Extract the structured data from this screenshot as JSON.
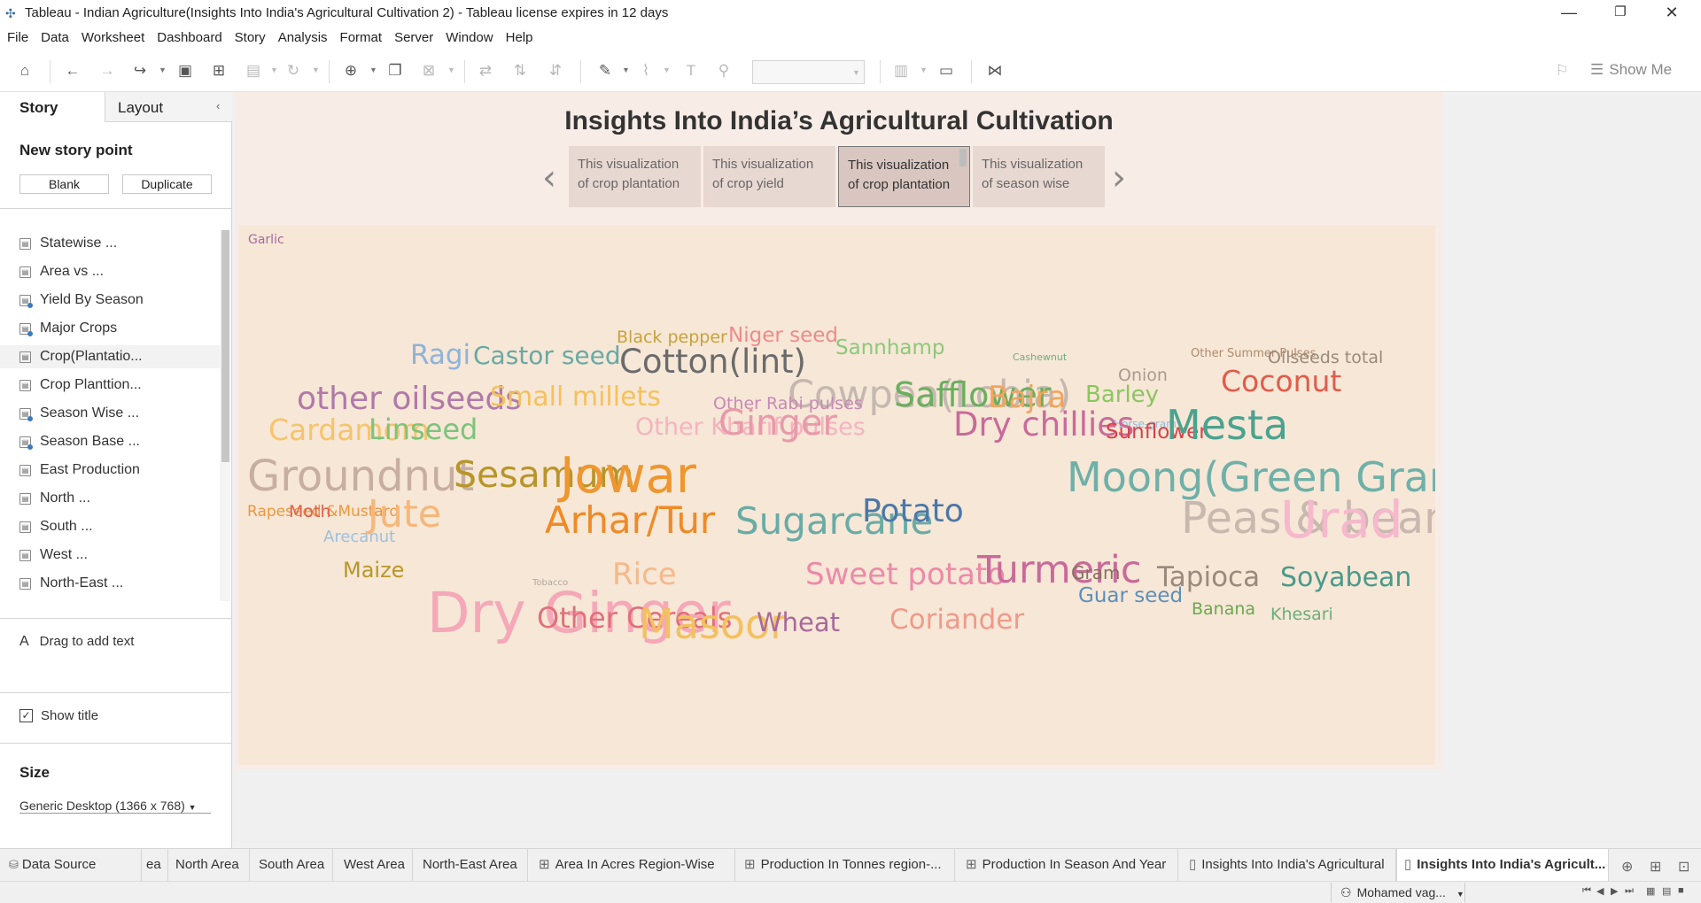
{
  "window": {
    "title": "Tableau - Indian Agriculture(Insights Into India's Agricultural Cultivation 2) - Tableau license expires in 12 days",
    "minimize": "—",
    "restore": "❐",
    "close": "✕"
  },
  "menu": [
    "File",
    "Data",
    "Worksheet",
    "Dashboard",
    "Story",
    "Analysis",
    "Format",
    "Server",
    "Window",
    "Help"
  ],
  "toolbar": {
    "show_me": "Show Me"
  },
  "left_panel": {
    "tab_story": "Story",
    "tab_layout": "Layout",
    "new_story_point": "New story point",
    "blank_button": "Blank",
    "duplicate_button": "Duplicate",
    "sheets": [
      "Statewise ...",
      "Area vs ...",
      "Yield By Season",
      "Major Crops",
      "Crop(Plantatio...",
      "Crop Planttion...",
      "Season Wise ...",
      "Season Base ...",
      "East Production",
      "North ...",
      "South ...",
      "West ...",
      "North-East ..."
    ],
    "drag_to_add_text": "Drag to add text",
    "show_title": "Show title",
    "size_label": "Size",
    "size_value": "Generic Desktop (1366 x 768)"
  },
  "story": {
    "title": "Insights Into India’s Agricultural Cultivation",
    "points": [
      {
        "line1": "This visualization",
        "line2": "of crop plantation"
      },
      {
        "line1": "This visualization",
        "line2": "of crop yield"
      },
      {
        "line1": "This visualization",
        "line2": "of crop plantation"
      },
      {
        "line1": "This visualization",
        "line2": "of season wise"
      }
    ],
    "active_point": 2
  },
  "word_cloud": [
    {
      "text": "Black pepper",
      "color": "#c9a23a"
    },
    {
      "text": "Niger seed",
      "color": "#f08a8a"
    },
    {
      "text": "Sannhamp",
      "color": "#8cc97a"
    },
    {
      "text": "Ragi",
      "color": "#8fb3d9"
    },
    {
      "text": "Castor seed",
      "color": "#6aa9a3"
    },
    {
      "text": "Cotton(lint)",
      "color": "#6b6b6b"
    },
    {
      "text": "Cashewnut",
      "color": "#6aaf7a"
    },
    {
      "text": "Other Summer Pulses",
      "color": "#b08a6a"
    },
    {
      "text": "Oilseeds total",
      "color": "#9a8a7a"
    },
    {
      "text": "Cowpea(Lobia)",
      "color": "#c4b8b0"
    },
    {
      "text": "Onion",
      "color": "#a89a8e"
    },
    {
      "text": "other oilseeds",
      "color": "#b07aa8"
    },
    {
      "text": "Small millets",
      "color": "#f3c15e"
    },
    {
      "text": "Other Rabi pulses",
      "color": "#c78ab3"
    },
    {
      "text": "Safflower",
      "color": "#6aaf5e"
    },
    {
      "text": "Bajra",
      "color": "#f5a35c"
    },
    {
      "text": "Barley",
      "color": "#8bc65e"
    },
    {
      "text": "Coconut",
      "color": "#e25b4a"
    },
    {
      "text": "Horse-gram",
      "color": "#8fbbe0"
    },
    {
      "text": "Cardamom",
      "color": "#f5c46b"
    },
    {
      "text": "Linseed",
      "color": "#7cc47a"
    },
    {
      "text": "Other Kharif pulses",
      "color": "#f5b3c0"
    },
    {
      "text": "Ginger",
      "color": "#e89aaa"
    },
    {
      "text": "Dry chillies",
      "color": "#c96a9a"
    },
    {
      "text": "Sunflower",
      "color": "#d9414a"
    },
    {
      "text": "Mesta",
      "color": "#4aa38f"
    },
    {
      "text": "Groundnut",
      "color": "#c7aea0"
    },
    {
      "text": "Sesamum",
      "color": "#b8952a"
    },
    {
      "text": "Jowar",
      "color": "#f0962e"
    },
    {
      "text": "Moong(Green Gram)",
      "color": "#6fb0a8"
    },
    {
      "text": "Rapeseed &Mustard",
      "color": "#f0963a"
    },
    {
      "text": "Moth",
      "color": "#e0614e"
    },
    {
      "text": "Arecanut",
      "color": "#9ec0de"
    },
    {
      "text": "Jute",
      "color": "#f5b77a"
    },
    {
      "text": "Arhar/Tur",
      "color": "#f08a25"
    },
    {
      "text": "Sugarcane",
      "color": "#6aaba5"
    },
    {
      "text": "Potato",
      "color": "#4b77a8"
    },
    {
      "text": "Peas & beans (Pulses)",
      "color": "#c8b8b0"
    },
    {
      "text": "Urad",
      "color": "#f5b8cc"
    },
    {
      "text": "Maize",
      "color": "#b89828"
    },
    {
      "text": "Tobacco",
      "color": "#b0a8a0"
    },
    {
      "text": "Dry Ginger",
      "color": "#f5a8b8"
    },
    {
      "text": "Rice",
      "color": "#f5b98a"
    },
    {
      "text": "Sweet potato",
      "color": "#ec8aa8"
    },
    {
      "text": "Turmeric",
      "color": "#c96a9a"
    },
    {
      "text": "Gram",
      "color": "#8a7060"
    },
    {
      "text": "Guar seed",
      "color": "#5e8fb8"
    },
    {
      "text": "Tapioca",
      "color": "#9a8a7e"
    },
    {
      "text": "Soyabean",
      "color": "#4a9a8a"
    },
    {
      "text": "Banana",
      "color": "#6aa84f"
    },
    {
      "text": "Khesari",
      "color": "#6aaf7a"
    },
    {
      "text": "Other Cereals",
      "color": "#e0707a"
    },
    {
      "text": "Masoor",
      "color": "#f3c15e"
    },
    {
      "text": "Wheat",
      "color": "#a86a9a"
    },
    {
      "text": "Coriander",
      "color": "#f09a8a"
    },
    {
      "text": "Garlic",
      "color": "#a86a9a"
    }
  ],
  "bottom_tabs": [
    {
      "label": "Data Source",
      "icon": "database-icon"
    },
    {
      "label": "ea",
      "icon": ""
    },
    {
      "label": "North Area",
      "icon": ""
    },
    {
      "label": "South Area",
      "icon": ""
    },
    {
      "label": "West Area",
      "icon": ""
    },
    {
      "label": "North-East Area",
      "icon": ""
    },
    {
      "label": "Area In Acres Region-Wise",
      "icon": "dashboard-icon"
    },
    {
      "label": "Production In Tonnes region-...",
      "icon": "dashboard-icon"
    },
    {
      "label": "Production In Season And Year",
      "icon": "dashboard-icon"
    },
    {
      "label": "Insights Into India's Agricultural",
      "icon": "story-icon"
    },
    {
      "label": "Insights Into India's Agricult...",
      "icon": "story-icon"
    }
  ],
  "status": {
    "user": "Mohamed vag..."
  }
}
